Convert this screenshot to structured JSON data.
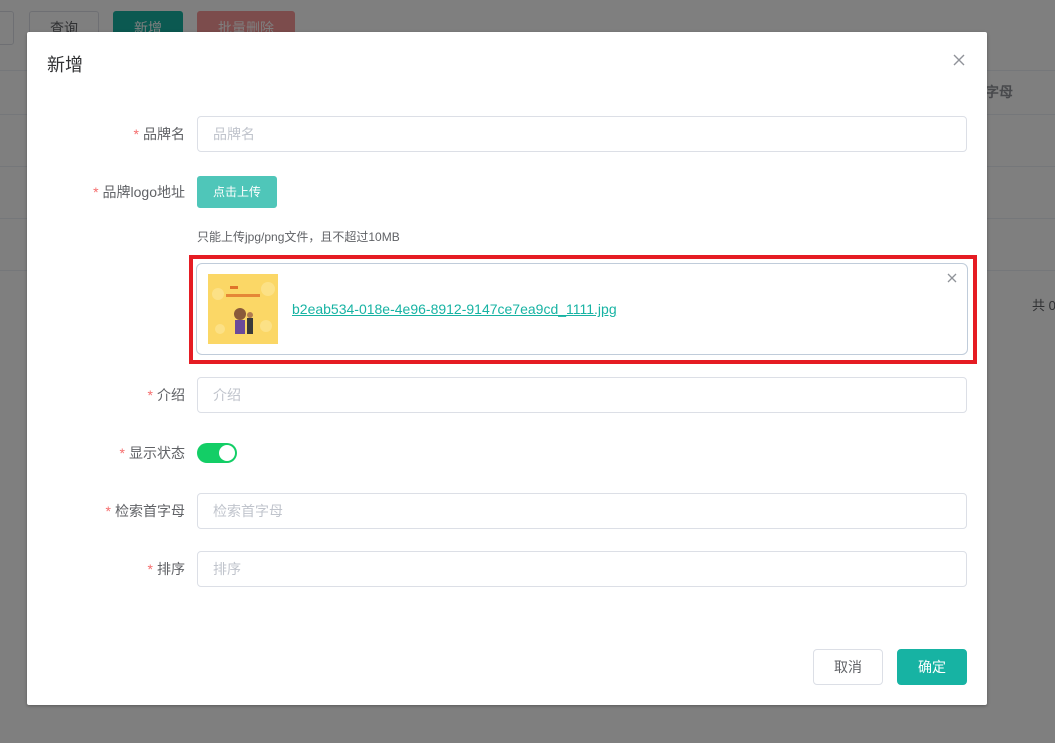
{
  "background": {
    "buttons": {
      "query": "查询",
      "add": "新增",
      "batch_delete": "批量删除"
    },
    "column_header_partial": "字母",
    "total_partial": "共 0"
  },
  "dialog": {
    "title": "新增",
    "close_icon": "close-icon",
    "fields": {
      "brand_name": {
        "label": "品牌名",
        "placeholder": "品牌名",
        "value": ""
      },
      "logo": {
        "label": "品牌logo地址",
        "upload_button": "点击上传",
        "tip": "只能上传jpg/png文件，且不超过10MB",
        "file": {
          "name": "b2eab534-018e-4e96-8912-9147ce7ea9cd_1111.jpg"
        }
      },
      "intro": {
        "label": "介绍",
        "placeholder": "介绍",
        "value": ""
      },
      "show_status": {
        "label": "显示状态",
        "enabled": true
      },
      "first_letter": {
        "label": "检索首字母",
        "placeholder": "检索首字母",
        "value": ""
      },
      "sort": {
        "label": "排序",
        "placeholder": "排序",
        "value": ""
      }
    },
    "required_mark": "*",
    "footer": {
      "cancel": "取消",
      "confirm": "确定"
    }
  },
  "colors": {
    "primary": "#17b3a3",
    "switch_on": "#13ce66",
    "required": "#f56c6c",
    "highlight": "#e51c23"
  }
}
